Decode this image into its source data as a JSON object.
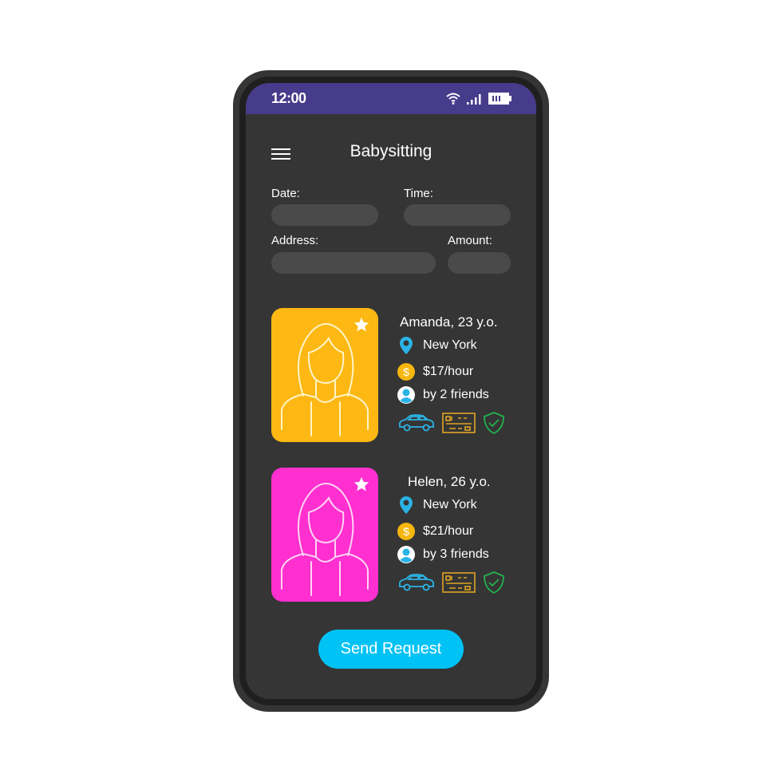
{
  "status_bar": {
    "time": "12:00",
    "icons": [
      "wifi-icon",
      "signal-icon",
      "battery-icon"
    ]
  },
  "header": {
    "menu_icon": "hamburger-menu-icon",
    "title": "Babysitting"
  },
  "form": {
    "date": {
      "label": "Date:",
      "value": "",
      "placeholder": ""
    },
    "time": {
      "label": "Time:",
      "value": "",
      "placeholder": ""
    },
    "address": {
      "label": "Address:",
      "value": "",
      "placeholder": ""
    },
    "amount": {
      "label": "Amount:",
      "value": "",
      "placeholder": ""
    }
  },
  "sitters": [
    {
      "name": "Amanda, 23 y.o.",
      "location": "New York",
      "rate": "$17/hour",
      "recommended": "by 2 friends",
      "card_color": "#fdb813",
      "favorite_icon": "star-icon",
      "badges": [
        "car-icon",
        "id-card-icon",
        "shield-check-icon"
      ]
    },
    {
      "name": "Helen, 26 y.o.",
      "location": "New York",
      "rate": "$21/hour",
      "recommended": "by 3 friends",
      "card_color": "#ff2fd0",
      "favorite_icon": "star-icon",
      "badges": [
        "car-icon",
        "id-card-icon",
        "shield-check-icon"
      ]
    }
  ],
  "actions": {
    "send_label": "Send Request"
  },
  "colors": {
    "status_bar": "#473b8b",
    "background": "#353535",
    "accent": "#00c2f5",
    "field": "#4a4a4a",
    "car_icon": "#2ab4e6",
    "id_icon": "#e0a422",
    "shield_icon": "#22b24c"
  }
}
